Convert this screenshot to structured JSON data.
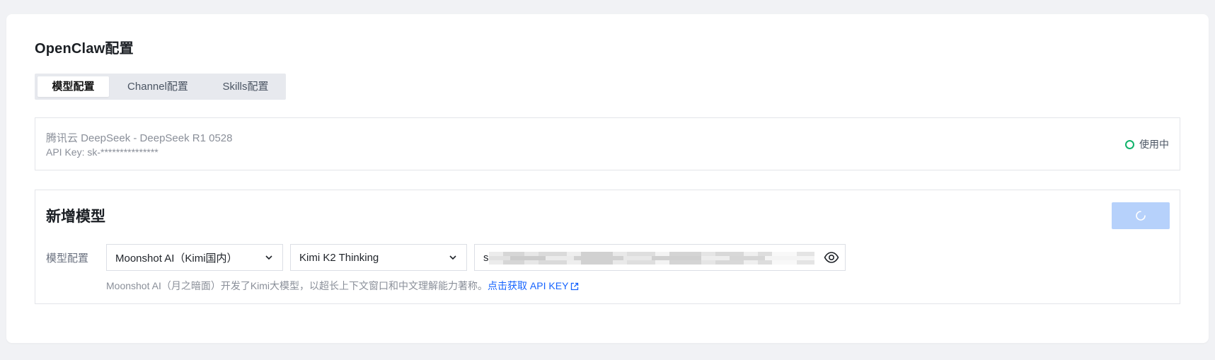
{
  "page": {
    "title": "OpenClaw配置"
  },
  "tabs": [
    {
      "label": "模型配置",
      "active": true
    },
    {
      "label": "Channel配置",
      "active": false
    },
    {
      "label": "Skills配置",
      "active": false
    }
  ],
  "current_model": {
    "name": "腾讯云 DeepSeek - DeepSeek R1 0528",
    "api_key": "API Key: sk-***************",
    "status": "使用中",
    "status_color": "#11b36b"
  },
  "add_model": {
    "title": "新增模型",
    "field_label": "模型配置",
    "provider_value": "Moonshot AI（Kimi国内）",
    "model_value": "Kimi K2 Thinking",
    "api_key_value": "s",
    "hint_text": "Moonshot AI（月之暗面）开发了Kimi大模型，以超长上下文窗口和中文理解能力著称。",
    "hint_link": "点击获取 API KEY",
    "button_color": "#b6d1fb",
    "icons": [
      "chevron-down-icon",
      "eye-icon",
      "external-link-icon",
      "loading-spinner-icon"
    ]
  },
  "colors": {
    "accent": "#1664ff",
    "background": "#f1f2f5"
  }
}
